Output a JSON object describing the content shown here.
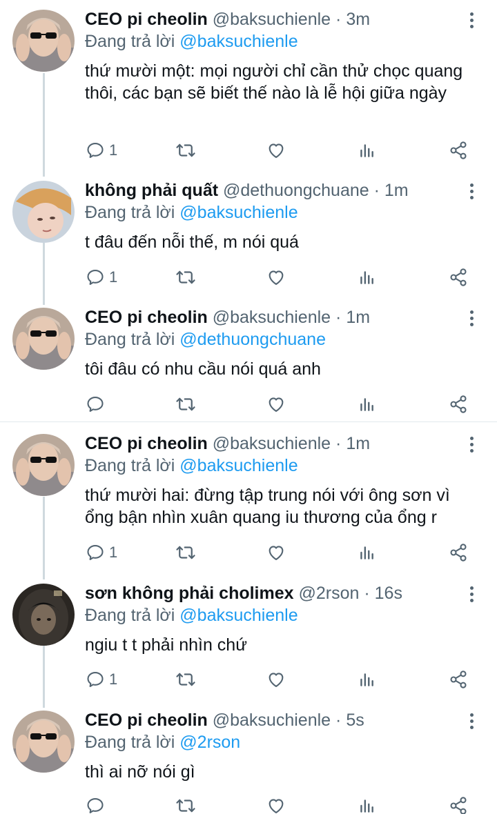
{
  "replying_prefix": "Đang trả lời",
  "colors": {
    "mention": "#1d9bf0",
    "secondary": "#536471",
    "thread_line": "#cfd9de"
  },
  "tweets": [
    {
      "name": "CEO pi cheolin",
      "handle": "@baksuchienle",
      "dot": "·",
      "time": "3m",
      "replying_to": "@baksuchienle",
      "text": "thứ mười một: mọi người chỉ cần thử chọc quang thôi, các bạn sẽ biết thế nào là lễ hội giữa ngày",
      "reply_count": "1",
      "avatar": "sunglasses-guy-avatar"
    },
    {
      "name": "không phải quất",
      "handle": "@dethuongchuane",
      "dot": "·",
      "time": "1m",
      "replying_to": "@baksuchienle",
      "text": "t đâu đến nỗi thế, m nói quá",
      "reply_count": "1",
      "avatar": "selfie-guy-avatar"
    },
    {
      "name": "CEO pi cheolin",
      "handle": "@baksuchienle",
      "dot": "·",
      "time": "1m",
      "replying_to": "@dethuongchuane",
      "text": "tôi đâu có nhu cầu nói quá anh",
      "reply_count": "",
      "avatar": "sunglasses-guy-avatar"
    },
    {
      "name": "CEO pi cheolin",
      "handle": "@baksuchienle",
      "dot": "·",
      "time": "1m",
      "replying_to": "@baksuchienle",
      "text": "thứ mười hai: đừng tập trung nói với ông sơn vì ổng bận nhìn xuân quang iu thương của ổng r",
      "reply_count": "1",
      "avatar": "sunglasses-guy-avatar"
    },
    {
      "name": "sơn không phải cholimex",
      "handle": "@2rson",
      "dot": "·",
      "time": "16s",
      "replying_to": "@baksuchienle",
      "text": "ngiu t t phải nhìn chứ",
      "reply_count": "1",
      "avatar": "hooded-guy-avatar"
    },
    {
      "name": "CEO pi cheolin",
      "handle": "@baksuchienle",
      "dot": "·",
      "time": "5s",
      "replying_to": "@2rson",
      "text": "thì ai nỡ nói gì",
      "reply_count": "",
      "avatar": "sunglasses-guy-avatar"
    }
  ]
}
